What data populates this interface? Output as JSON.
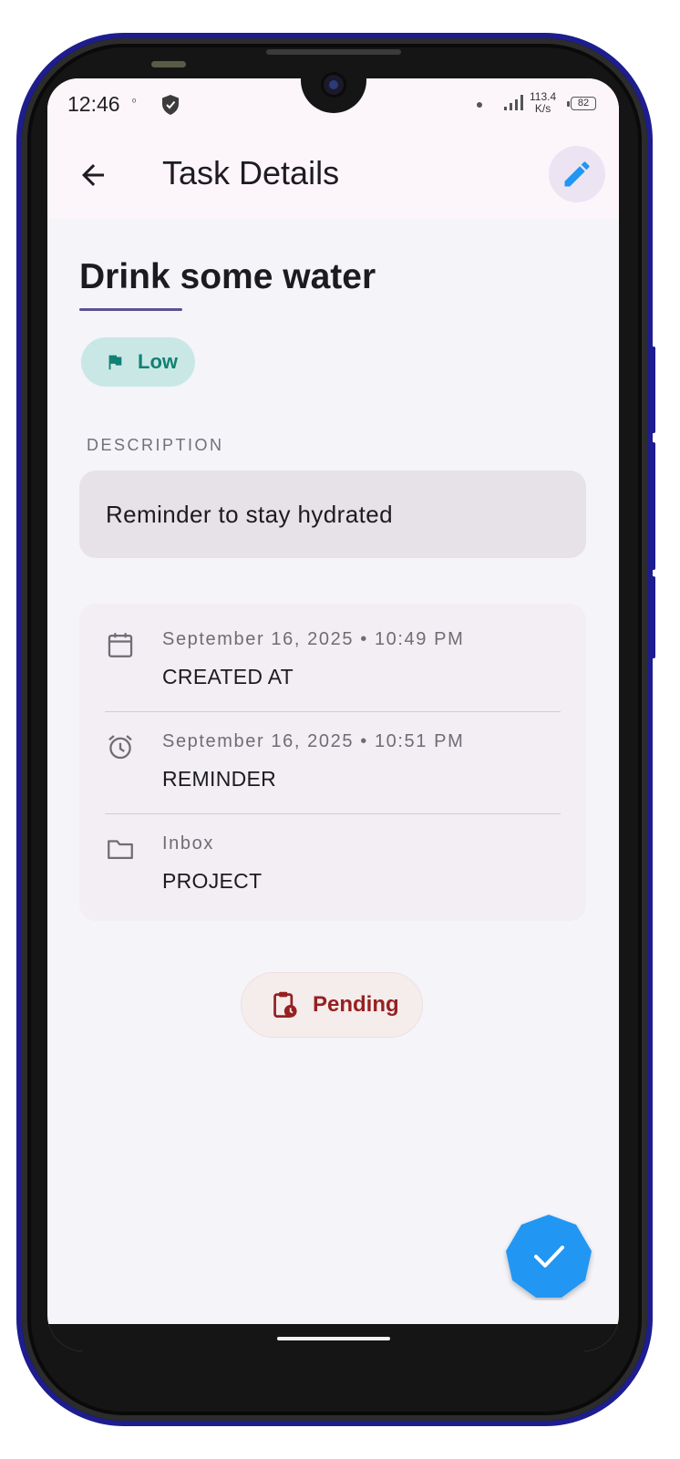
{
  "status_bar": {
    "time": "12:46",
    "small_indicator": "ᵒ",
    "network_speed_value": "113.4",
    "network_speed_unit": "K/s",
    "battery": "82"
  },
  "app_bar": {
    "title": "Task Details",
    "back_icon": "arrow-left-icon",
    "edit_icon": "pencil-icon"
  },
  "task": {
    "title": "Drink some water",
    "priority": "Low",
    "description_heading": "DESCRIPTION",
    "description": "Reminder to stay hydrated",
    "details": [
      {
        "icon": "calendar-icon",
        "value": "September 16, 2025 • 10:49 PM",
        "label": "CREATED AT"
      },
      {
        "icon": "alarm-icon",
        "value": "September 16, 2025 • 10:51 PM",
        "label": "REMINDER"
      },
      {
        "icon": "folder-icon",
        "value": "Inbox",
        "label": "PROJECT"
      }
    ],
    "status": "Pending"
  },
  "colors": {
    "accent_blue": "#2196f3",
    "priority_bg": "#c9e8e5",
    "priority_fg": "#138074",
    "status_fg": "#962121",
    "underline": "#5c5193"
  }
}
